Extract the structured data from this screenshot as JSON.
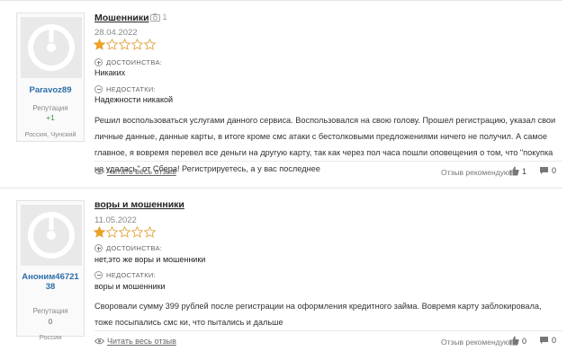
{
  "reviews": [
    {
      "author": "Paravoz89",
      "reputation_label": "Репутация",
      "reputation_value": "+1",
      "location": "Россия, Чунский",
      "title": "Мошенники",
      "photo_count": "1",
      "date": "28.04.2022",
      "rating": 1,
      "max_rating": 5,
      "pros_label": "ДОСТОИНСТВА:",
      "pros": "Никаких",
      "cons_label": "НЕДОСТАТКИ:",
      "cons": "Надежности никакой",
      "text": "Решил воспользоваться услугами данного сервиса. Воспользовался на свою голову. Прошел регистрацию, указал свои личные данные, данные карты, в итоге кроме смс атаки с бестолковыми предложениями ничего не получил. А самое главное, я вовремя перевел все деньги на другую карту, так как через пол часа пошли оповещения о том, что \"покупка не удалась\" от Сбера! Регистрируетесь, а у вас последнее",
      "read_more": "Читать весь отзыв",
      "recommend_label": "Отзыв рекомендуют:",
      "likes": "1",
      "comments": "0"
    },
    {
      "author": "Аноним4672138",
      "reputation_label": "Репутация",
      "reputation_value": "0",
      "location": "Россия",
      "title": "воры и мошенники",
      "date": "11.05.2022",
      "rating": 1,
      "max_rating": 5,
      "pros_label": "ДОСТОИНСТВА:",
      "pros": "нет,это же воры и мошенники",
      "cons_label": "НЕДОСТАТКИ:",
      "cons": "воры и мошенники",
      "text": "Своровали сумму 399 рублей после регистрации на оформления кредитного займа. Вовремя карту заблокировала, тоже посыпались смс ки, что пытались и дальше",
      "read_more": "Читать весь отзыв",
      "recommend_label": "Отзыв рекомендуют:",
      "likes": "0",
      "comments": "0"
    }
  ],
  "colors": {
    "star_filled": "#f0a21b",
    "star_empty_stroke": "#e2a640",
    "username": "#2d6ea8",
    "rep_positive": "#3a9a3a"
  }
}
